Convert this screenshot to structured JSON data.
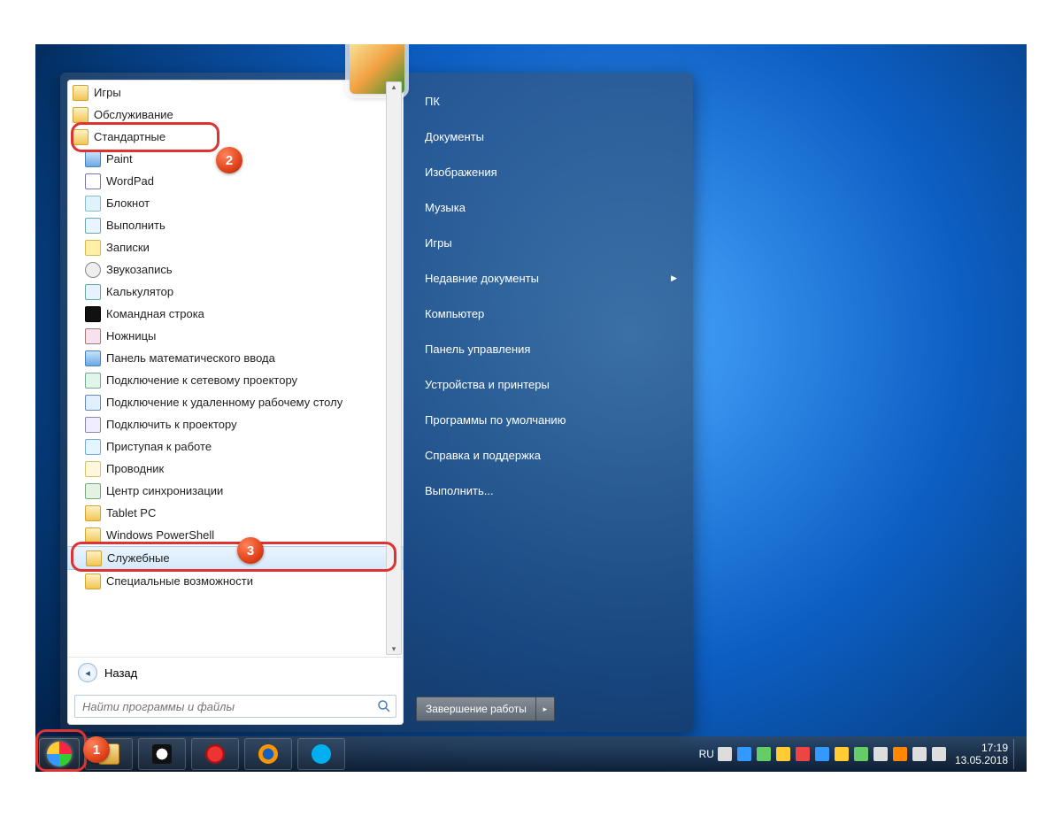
{
  "left_pane": {
    "items": [
      {
        "label": "Игры",
        "icon": "folder",
        "indent": 0
      },
      {
        "label": "Обслуживание",
        "icon": "folder",
        "indent": 0
      },
      {
        "label": "Стандартные",
        "icon": "folder",
        "indent": 0,
        "highlight": true
      },
      {
        "label": "Paint",
        "icon": "generic",
        "indent": 1
      },
      {
        "label": "WordPad",
        "icon": "wordpad",
        "indent": 1
      },
      {
        "label": "Блокнот",
        "icon": "notepad",
        "indent": 1
      },
      {
        "label": "Выполнить",
        "icon": "run",
        "indent": 1
      },
      {
        "label": "Записки",
        "icon": "notes",
        "indent": 1
      },
      {
        "label": "Звукозапись",
        "icon": "mic",
        "indent": 1
      },
      {
        "label": "Калькулятор",
        "icon": "calc",
        "indent": 1
      },
      {
        "label": "Командная строка",
        "icon": "cmd",
        "indent": 1
      },
      {
        "label": "Ножницы",
        "icon": "snip",
        "indent": 1
      },
      {
        "label": "Панель математического ввода",
        "icon": "generic",
        "indent": 1
      },
      {
        "label": "Подключение к сетевому проектору",
        "icon": "net",
        "indent": 1
      },
      {
        "label": "Подключение к удаленному рабочему столу",
        "icon": "remote",
        "indent": 1
      },
      {
        "label": "Подключить к проектору",
        "icon": "proj",
        "indent": 1
      },
      {
        "label": "Приступая к работе",
        "icon": "start",
        "indent": 1
      },
      {
        "label": "Проводник",
        "icon": "explorer",
        "indent": 1
      },
      {
        "label": "Центр синхронизации",
        "icon": "sync",
        "indent": 1
      },
      {
        "label": "Tablet PC",
        "icon": "folder",
        "indent": 1
      },
      {
        "label": "Windows PowerShell",
        "icon": "folder",
        "indent": 1
      },
      {
        "label": "Служебные",
        "icon": "folder",
        "indent": 1,
        "selected": true,
        "highlight": true
      },
      {
        "label": "Специальные возможности",
        "icon": "folder",
        "indent": 1
      }
    ],
    "back_label": "Назад",
    "search_placeholder": "Найти программы и файлы"
  },
  "right_pane": {
    "items": [
      {
        "label": "ПК"
      },
      {
        "label": "Документы"
      },
      {
        "label": "Изображения"
      },
      {
        "label": "Музыка"
      },
      {
        "label": "Игры"
      },
      {
        "label": "Недавние документы",
        "submenu": true
      },
      {
        "label": "Компьютер"
      },
      {
        "label": "Панель управления"
      },
      {
        "label": "Устройства и принтеры"
      },
      {
        "label": "Программы по умолчанию"
      },
      {
        "label": "Справка и поддержка"
      },
      {
        "label": "Выполнить..."
      }
    ],
    "shutdown_label": "Завершение работы"
  },
  "taskbar": {
    "lang": "RU",
    "time": "17:19",
    "date": "13.05.2018"
  },
  "annotations": {
    "b1": "1",
    "b2": "2",
    "b3": "3"
  }
}
